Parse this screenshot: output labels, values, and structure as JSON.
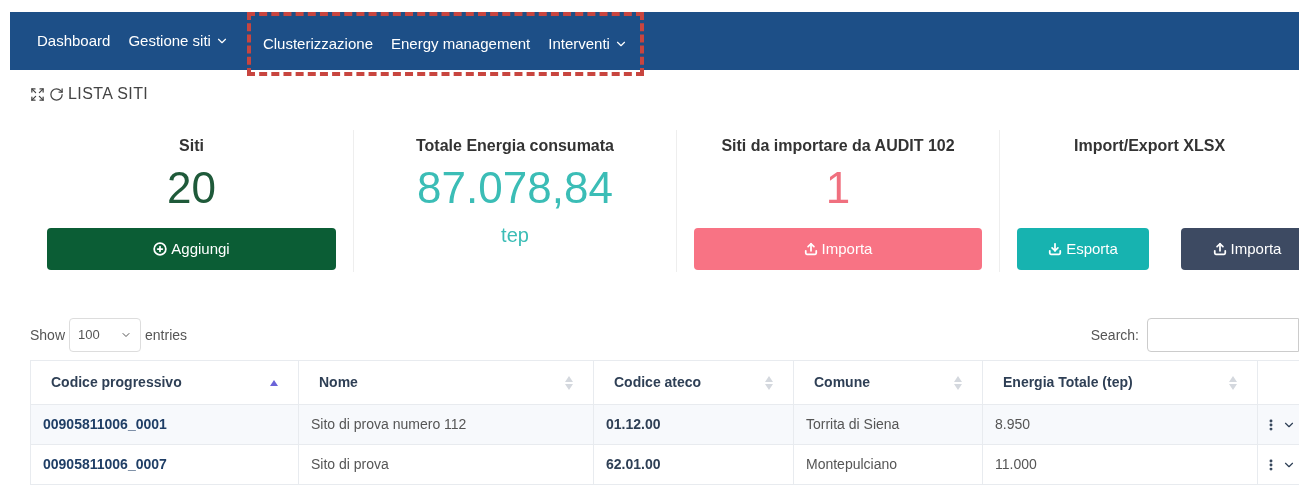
{
  "navbar": {
    "items": [
      {
        "label": "Dashboard",
        "dropdown": false
      },
      {
        "label": "Gestione siti",
        "dropdown": true
      }
    ],
    "highlighted_group": {
      "items": [
        {
          "label": "Clusterizzazione",
          "dropdown": false
        },
        {
          "label": "Energy management",
          "dropdown": false
        },
        {
          "label": "Interventi",
          "dropdown": true
        }
      ]
    }
  },
  "page_title": "LISTA SITI",
  "stats": [
    {
      "title": "Siti",
      "value": "20",
      "color": "#1f5a3a",
      "buttons": [
        {
          "label": "Aggiungi",
          "kind": "add"
        }
      ]
    },
    {
      "title": "Totale Energia consumata",
      "value": "87.078,84",
      "unit": "tep",
      "color": "#3bbdb6"
    },
    {
      "title": "Siti da importare da AUDIT 102",
      "value": "1",
      "color": "#f0707f",
      "buttons": [
        {
          "label": "Importa",
          "kind": "import-red"
        }
      ]
    },
    {
      "title": "Import/Export XLSX",
      "buttons": [
        {
          "label": "Esporta",
          "kind": "export"
        },
        {
          "label": "Importa",
          "kind": "import-dark"
        }
      ]
    }
  ],
  "table_controls": {
    "show_label": "Show",
    "page_size": "100",
    "entries_label": "entries",
    "search_label": "Search:"
  },
  "table": {
    "columns": [
      {
        "label": "Codice progressivo",
        "kind": "sorted"
      },
      {
        "label": "Nome",
        "kind": "sortable"
      },
      {
        "label": "Codice ateco",
        "kind": "sortable"
      },
      {
        "label": "Comune",
        "kind": "sortable"
      },
      {
        "label": "Energia Totale (tep)",
        "kind": "sortable"
      },
      {
        "kind": "plain"
      }
    ],
    "rows": [
      {
        "code": "00905811006_0001",
        "name": "Sito di prova numero 112",
        "ateco": "01.12.00",
        "comune": "Torrita di Siena",
        "energia": "8.950"
      },
      {
        "code": "00905811006_0007",
        "name": "Sito di prova",
        "ateco": "62.01.00",
        "comune": "Montepulciano",
        "energia": "11.000"
      }
    ]
  }
}
